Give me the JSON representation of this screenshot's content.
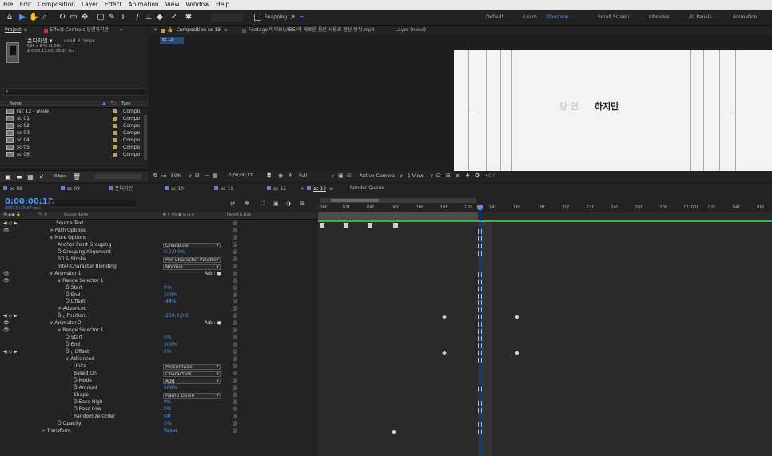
{
  "menu": [
    "File",
    "Edit",
    "Composition",
    "Layer",
    "Effect",
    "Animation",
    "View",
    "Window",
    "Help"
  ],
  "toolbar": {
    "snapping": "Snapping",
    "workspaces": [
      {
        "label": "Default",
        "active": false
      },
      {
        "label": "Learn",
        "active": false
      },
      {
        "label": "Standard",
        "active": true
      },
      {
        "label": "Small Screen",
        "active": false
      },
      {
        "label": "Libraries",
        "active": false
      },
      {
        "label": "All Panels",
        "active": false
      },
      {
        "label": "Animation",
        "active": false
      }
    ]
  },
  "project": {
    "tab": "Project",
    "effect_tab": "Effect Controls 당연하지만",
    "item_name": "폰디자인 ▾",
    "used": "used 3 times",
    "dims": "596 x 842 (1.00)",
    "duration": "Δ 0;00;15;00, 29.97 fps",
    "col_name": "Name",
    "col_type": "Type",
    "items": [
      {
        "name": "[sc 12 - wave]",
        "type": "Compo"
      },
      {
        "name": "sc 01",
        "type": "Compo"
      },
      {
        "name": "sc 02",
        "type": "Compo"
      },
      {
        "name": "sc 03",
        "type": "Compo"
      },
      {
        "name": "sc 04",
        "type": "Compo"
      },
      {
        "name": "sc 05",
        "type": "Compo"
      },
      {
        "name": "sc 06",
        "type": "Compo"
      }
    ],
    "bpc": "8 bpc"
  },
  "viewer": {
    "comp_tab": "Composition sc 13",
    "footage_tab": "Footage 바이브(VIBE)의 새로운 음원 사용료 정산 방식.mp4",
    "layer_tab": "Layer (none)",
    "comp_name": "sc 13",
    "canvas_text_light": "당 연",
    "canvas_text_bold": "하지만",
    "zoom": "50%",
    "timecode": "0;00;00;13",
    "quality": "Full",
    "camera": "Active Camera",
    "views": "1 View",
    "exposure": "+0.0"
  },
  "timeline": {
    "tabs": [
      {
        "label": "sc 08",
        "color": "#6a7fc1",
        "active": false
      },
      {
        "label": "sc 09",
        "color": "#6a7fc1",
        "active": false
      },
      {
        "label": "폰디자인",
        "color": "#6a7fc1",
        "active": false
      },
      {
        "label": "sc 10",
        "color": "#6a7fc1",
        "active": false
      },
      {
        "label": "sc 11",
        "color": "#6a7fc1",
        "active": false
      },
      {
        "label": "sc 12",
        "color": "#6a7fc1",
        "active": false
      },
      {
        "label": "sc 13",
        "color": "#6a7fc1",
        "active": true
      },
      {
        "label": "Render Queue",
        "color": "",
        "active": false
      }
    ],
    "timecode": "0;00;00;13",
    "fps": "00013 (29.97 fps)",
    "col_source": "Source Name",
    "col_parent": "Parent & Link",
    "ruler": [
      ":00f",
      "02f",
      "04f",
      "06f",
      "08f",
      "10f",
      "12f",
      "14f",
      "16f",
      "18f",
      "20f",
      "22f",
      "24f",
      "26f",
      "28f",
      "01:00f",
      "02f",
      "04f",
      "06f"
    ],
    "rows": [
      {
        "indent": 0,
        "label": "Source Text",
        "value": "",
        "stopwatch": true,
        "eye": false,
        "nav": true
      },
      {
        "indent": 1,
        "label": "> Path Options",
        "value": "",
        "eye": true
      },
      {
        "indent": 1,
        "label": "∨ More Options",
        "value": ""
      },
      {
        "indent": 2,
        "label": "Anchor Point Grouping",
        "value": "Character",
        "dropdown": true
      },
      {
        "indent": 2,
        "label": "Ö Grouping Alignment",
        "value": "0.0,0.0%",
        "blue": true
      },
      {
        "indent": 2,
        "label": "Fill & Stroke",
        "value": "Per Character Palette",
        "dropdown": true
      },
      {
        "indent": 2,
        "label": "Inter-Character Blending",
        "value": "Normal",
        "dropdown": true
      },
      {
        "indent": 1,
        "label": "∨ Animator 1",
        "value": "",
        "add": true,
        "eye": true
      },
      {
        "indent": 2,
        "label": "∨ Range Selector 1",
        "value": "",
        "eye": true
      },
      {
        "indent": 3,
        "label": "Ö Start",
        "value": "0%",
        "blue": true
      },
      {
        "indent": 3,
        "label": "Ö End",
        "value": "100%",
        "blue": true
      },
      {
        "indent": 3,
        "label": "Ö Offset",
        "value": "-48%",
        "blue": true
      },
      {
        "indent": 2,
        "label": "> Advanced",
        "value": ""
      },
      {
        "indent": 2,
        "label": "Ö ⌞ Position",
        "value": "-259.0,0.0",
        "blue": true,
        "nav": true
      },
      {
        "indent": 1,
        "label": "∨ Animator 2",
        "value": "",
        "add": true,
        "eye": true
      },
      {
        "indent": 2,
        "label": "∨ Range Selector 1",
        "value": "",
        "eye": true
      },
      {
        "indent": 3,
        "label": "Ö Start",
        "value": "0%",
        "blue": true
      },
      {
        "indent": 3,
        "label": "Ö End",
        "value": "100%",
        "blue": true
      },
      {
        "indent": 3,
        "label": "Ö ⌞ Offset",
        "value": "0%",
        "blue": true,
        "nav": true
      },
      {
        "indent": 3,
        "label": "∨ Advanced",
        "value": ""
      },
      {
        "indent": 4,
        "label": "Units",
        "value": "Percentage",
        "dropdown": true
      },
      {
        "indent": 4,
        "label": "Based On",
        "value": "Characters",
        "dropdown": true
      },
      {
        "indent": 4,
        "label": "Ö Mode",
        "value": "Add",
        "dropdown": true
      },
      {
        "indent": 4,
        "label": "Ö Amount",
        "value": "100%",
        "blue": true
      },
      {
        "indent": 4,
        "label": "Shape",
        "value": "Ramp Down",
        "dropdown": true
      },
      {
        "indent": 4,
        "label": "Ö Ease High",
        "value": "0%",
        "blue": true
      },
      {
        "indent": 4,
        "label": "Ö Ease Low",
        "value": "0%",
        "blue": true
      },
      {
        "indent": 4,
        "label": "Randomize Order",
        "value": "Off",
        "blue": true
      },
      {
        "indent": 2,
        "label": "Ö Opacity",
        "value": "0%",
        "blue": true
      },
      {
        "indent": 0,
        "label": "> Transform",
        "value": "Reset",
        "blue": true
      }
    ],
    "add_label": "Add:"
  },
  "colors": {
    "accent": "#4d95ff",
    "label": "#c3a14e",
    "green": "#3bb34a"
  }
}
